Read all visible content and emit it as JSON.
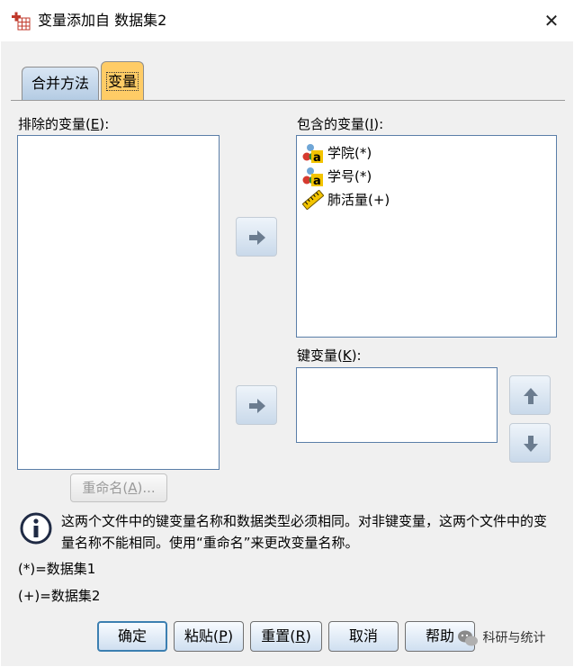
{
  "window": {
    "title": "变量添加自 数据集2",
    "close_glyph": "✕"
  },
  "tabs": [
    {
      "label": "合并方法",
      "selected": false
    },
    {
      "label": "变量",
      "selected": true
    }
  ],
  "excluded": {
    "label_prefix": "排除的变量(",
    "label_mnemonic": "E",
    "label_suffix": "):"
  },
  "included": {
    "label_prefix": "包含的变量(",
    "label_mnemonic": "I",
    "label_suffix": "):",
    "items": [
      {
        "name": "学院(*)",
        "icon": "nominal-string-icon"
      },
      {
        "name": "学号(*)",
        "icon": "nominal-string-icon"
      },
      {
        "name": "肺活量(+)",
        "icon": "scale-ruler-icon"
      }
    ]
  },
  "key": {
    "label_prefix": "键变量(",
    "label_mnemonic": "K",
    "label_suffix": "):"
  },
  "rename": {
    "label_prefix": "重命名(",
    "label_mnemonic": "A",
    "label_suffix": ")..."
  },
  "info": {
    "text": "这两个文件中的键变量名称和数据类型必须相同。对非键变量，这两个文件中的变量名称不能相同。使用“重命名”来更改变量名称。"
  },
  "legend": {
    "dataset1": "(*)=数据集1",
    "dataset2": "(+)=数据集2"
  },
  "buttons": {
    "ok": "确定",
    "paste_prefix": "粘贴(",
    "paste_mnemonic": "P",
    "paste_suffix": ")",
    "reset_prefix": "重置(",
    "reset_mnemonic": "R",
    "reset_suffix": ")",
    "cancel": "取消",
    "help": "帮助"
  },
  "watermark": "科研与统计",
  "colors": {
    "selected_tab": "#ffcc66",
    "list_border": "#5a7ea8",
    "dialog_bg": "#f0f0f0"
  }
}
